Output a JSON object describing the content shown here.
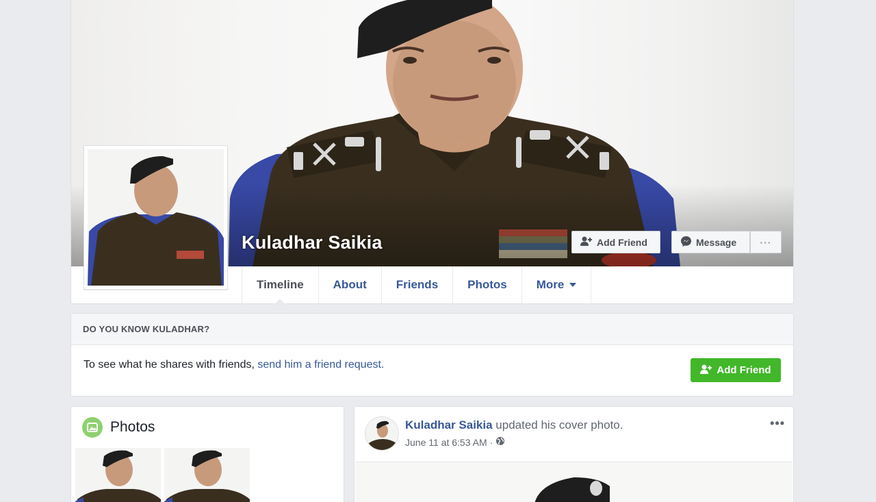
{
  "profile": {
    "name": "Kuladhar Saikia",
    "add_friend_label": "Add Friend",
    "message_label": "Message",
    "more_options_label": "···"
  },
  "tabs": [
    {
      "label": "Timeline",
      "active": true
    },
    {
      "label": "About"
    },
    {
      "label": "Friends"
    },
    {
      "label": "Photos"
    },
    {
      "label": "More"
    }
  ],
  "know": {
    "heading": "DO YOU KNOW KULADHAR?",
    "text": "To see what he shares with friends,",
    "link": "send him a friend request.",
    "button_label": "Add Friend"
  },
  "photos": {
    "title": "Photos"
  },
  "post": {
    "author": "Kuladhar Saikia",
    "action": "updated his cover photo.",
    "time": "June 11 at 6:53 AM",
    "separator": "·",
    "dots": "•••"
  },
  "colors": {
    "link": "#365899",
    "green_button": "#42b72a",
    "page_bg": "#e9ebee",
    "uniform": "#3a2f1f",
    "beret": "#1e1e1e"
  }
}
